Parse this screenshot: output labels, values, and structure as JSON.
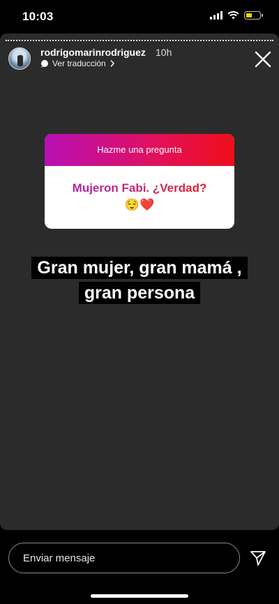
{
  "status_bar": {
    "time": "10:03",
    "battery_level": 0.45
  },
  "story": {
    "username": "rodrigomarinrodriguez",
    "time_ago": "10h",
    "translate_label": "Ver traducción",
    "question_sticker": {
      "prompt": "Hazme una pregunta",
      "answer": "Mujeron Fabi. ¿Verdad?",
      "emojis": "😌❤️"
    },
    "caption_lines": [
      "Gran mujer, gran mamá ,",
      "gran persona"
    ]
  },
  "reply": {
    "placeholder": "Enviar mensaje"
  },
  "icons": {
    "close": "close-icon",
    "send": "send-icon"
  }
}
